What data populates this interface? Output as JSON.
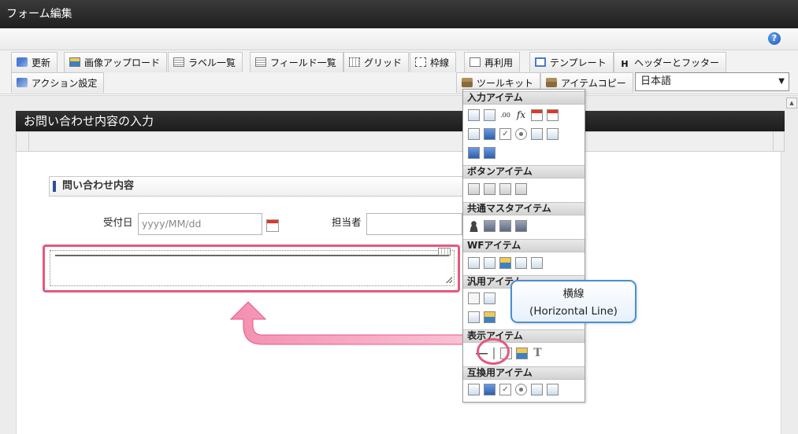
{
  "window": {
    "title": "フォーム編集"
  },
  "help": {
    "icon": "help-icon",
    "glyph": "?"
  },
  "toolbar": {
    "buttons": [
      {
        "label": "更新",
        "icon": "refresh-icon"
      },
      {
        "label": "画像アップロード",
        "icon": "image-upload-icon"
      },
      {
        "label": "ラベル一覧",
        "icon": "label-list-icon"
      },
      {
        "label": "フィールド一覧",
        "icon": "field-list-icon"
      },
      {
        "label": "グリッド",
        "icon": "grid-icon"
      },
      {
        "label": "枠線",
        "icon": "border-icon"
      },
      {
        "label": "再利用",
        "icon": "reuse-icon"
      },
      {
        "label": "テンプレート",
        "icon": "template-icon"
      },
      {
        "label": "ヘッダーとフッター",
        "icon": "header-footer-icon",
        "glyph": "H"
      },
      {
        "label": "アクション設定",
        "icon": "action-icon"
      },
      {
        "label": "ツールキット",
        "icon": "toolkit-icon"
      },
      {
        "label": "アイテムコピー",
        "icon": "item-copy-icon"
      }
    ],
    "language": {
      "value": "日本語",
      "arrow": "▼"
    }
  },
  "form": {
    "title": "お問い合わせ内容の入力",
    "section_title": "問い合わせ内容",
    "fields": {
      "receipt_date_label": "受付日",
      "receipt_date_placeholder": "yyyy/MM/dd",
      "assignee_label": "担当者"
    }
  },
  "palette": {
    "sections": [
      {
        "title": "入力アイテム"
      },
      {
        "title": "ボタンアイテム"
      },
      {
        "title": "共通マスタアイテム"
      },
      {
        "title": "WFアイテム"
      },
      {
        "title": "汎用アイテム"
      },
      {
        "title": "表示アイテム"
      },
      {
        "title": "互換用アイテム"
      }
    ],
    "icon_glyphs": {
      "decimal": ".00",
      "formula": "fx",
      "text": "T",
      "check": "✓"
    }
  },
  "callout": {
    "line1": "横線",
    "line2": "(Horizontal Line)"
  },
  "colors": {
    "highlight": "#e4587e",
    "callout_border": "#4c8ed1",
    "header_dark": "#1c1c1c"
  }
}
